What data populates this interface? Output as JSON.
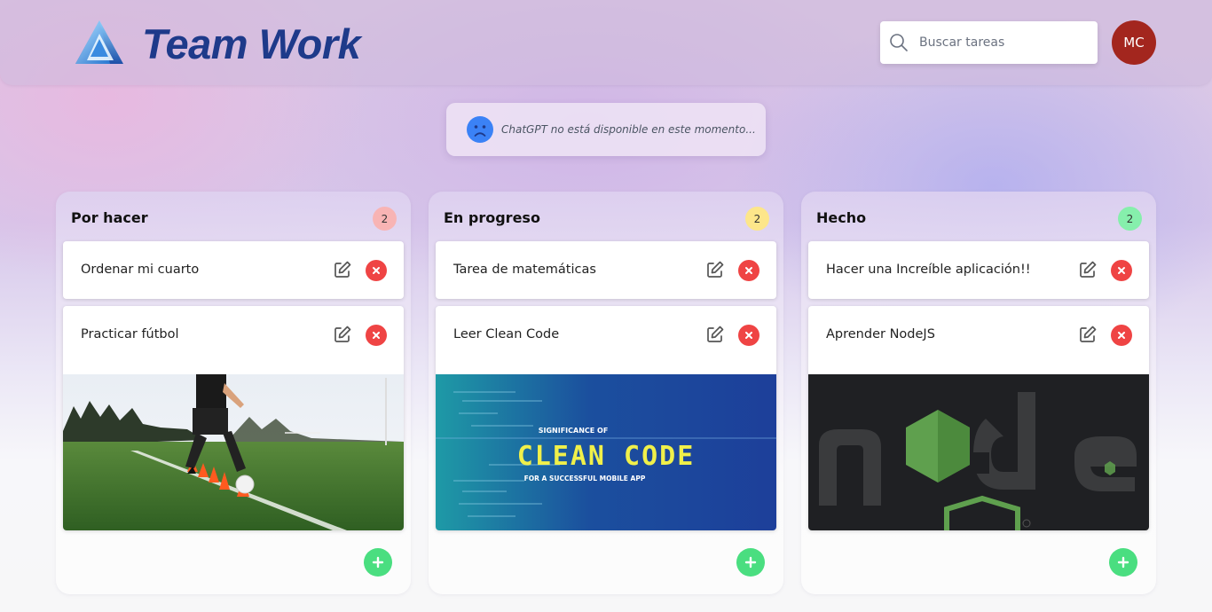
{
  "app": {
    "title": "Team Work",
    "logo_icon": "triangle-logo-icon",
    "brand_color": "#1e3a8a"
  },
  "search": {
    "placeholder": "Buscar tareas",
    "icon": "search-icon"
  },
  "user": {
    "initials": "MC",
    "avatar_color": "#a3261e"
  },
  "notice": {
    "icon": "sad-face-icon",
    "text": "ChatGPT no está disponible en este momento..."
  },
  "colors": {
    "delete": "#ef4444",
    "add": "#4ade80",
    "count_todo": "#f8b4b4",
    "count_progress": "#fde68a",
    "count_done": "#86efac"
  },
  "columns": [
    {
      "title": "Por hacer",
      "count": "2",
      "tasks": [
        {
          "text": "Ordenar mi cuarto"
        },
        {
          "text": "Practicar fútbol",
          "image": "soccer-training-photo"
        }
      ]
    },
    {
      "title": "En progreso",
      "count": "2",
      "tasks": [
        {
          "text": "Tarea de matemáticas"
        },
        {
          "text": "Leer Clean Code",
          "image": "clean-code-banner",
          "image_text": {
            "top": "SIGNIFICANCE OF",
            "main": "CLEAN CODE",
            "bottom": "FOR A SUCCESSFUL MOBILE APP"
          }
        }
      ]
    },
    {
      "title": "Hecho",
      "count": "2",
      "tasks": [
        {
          "text": "Hacer una Increíble aplicación!!"
        },
        {
          "text": "Aprender NodeJS",
          "image": "nodejs-logo-image"
        }
      ]
    }
  ]
}
